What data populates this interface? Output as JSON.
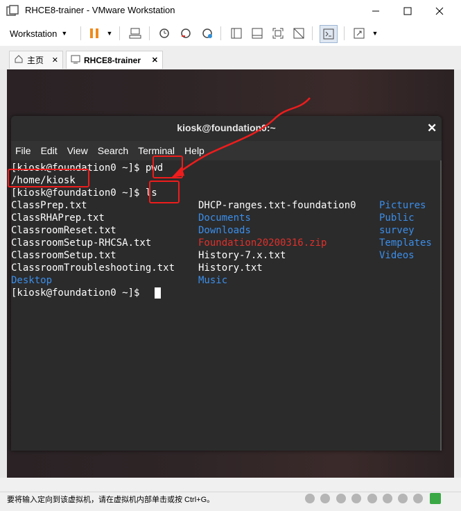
{
  "window": {
    "title": "RHCE8-trainer - VMware Workstation"
  },
  "toolbar": {
    "workstation_label": "Workstation"
  },
  "tabs": [
    {
      "label": "主页"
    },
    {
      "label": "RHCE8-trainer"
    }
  ],
  "terminal": {
    "title": "kiosk@foundation0:~",
    "menu": [
      "File",
      "Edit",
      "View",
      "Search",
      "Terminal",
      "Help"
    ],
    "lines": {
      "l1": "[kiosk@foundation0 ~]$ pwd",
      "l2": "/home/kiosk",
      "l3": "[kiosk@foundation0 ~]$ ls",
      "l10": "[kiosk@foundation0 ~]$ "
    },
    "ls_col1": [
      "ClassPrep.txt",
      "ClassRHAPrep.txt",
      "ClassroomReset.txt",
      "ClassroomSetup-RHCSA.txt",
      "ClassroomSetup.txt",
      "ClassroomTroubleshooting.txt",
      "Desktop"
    ],
    "ls_col2": [
      "DHCP-ranges.txt-foundation0",
      "Documents",
      "Downloads",
      "Foundation20200316.zip",
      "History-7.x.txt",
      "History.txt",
      "Music"
    ],
    "ls_col3": [
      "Pictures",
      "Public",
      "survey",
      "Templates",
      "Videos"
    ]
  },
  "status": {
    "message": "要将输入定向到该虚拟机，请在虚拟机内部单击或按 Ctrl+G。"
  },
  "colors": {
    "directory": "#3b8eea",
    "archive": "#e0302b",
    "annotation": "#ee1c1c"
  }
}
